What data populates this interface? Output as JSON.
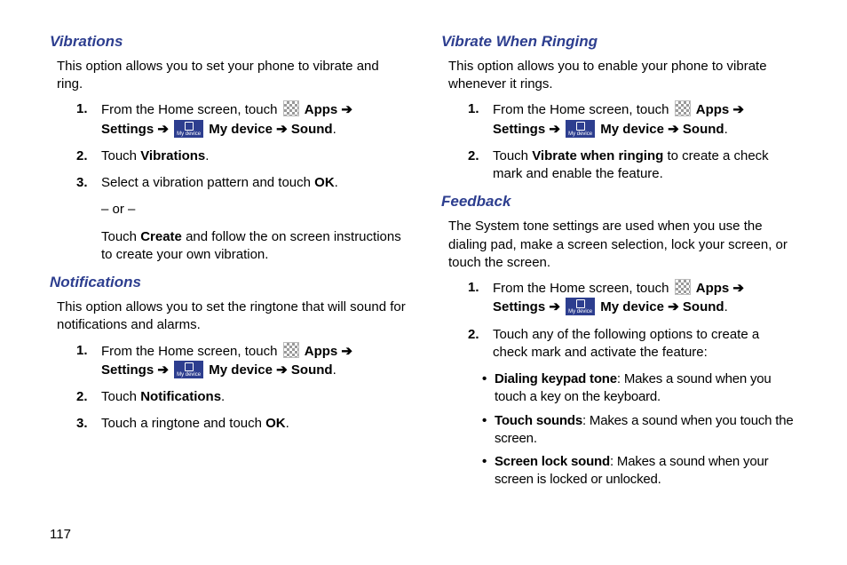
{
  "page_number": "117",
  "left": {
    "vibrations": {
      "heading": "Vibrations",
      "intro": "This option allows you to set your phone to vibrate and ring.",
      "steps": [
        {
          "num": "1.",
          "pre": "From the Home screen, touch ",
          "apps": "Apps",
          "arrow1": " ➔ ",
          "settings": "Settings",
          "arrow2": " ➔ ",
          "mydevice_badge": "My device",
          "mydevice": "My device",
          "arrow3": " ➔ ",
          "sound": "Sound",
          "post": "."
        },
        {
          "num": "2.",
          "pre": "Touch ",
          "bold": "Vibrations",
          "post": "."
        },
        {
          "num": "3.",
          "pre": "Select a vibration pattern and touch ",
          "bold": "OK",
          "post": "."
        }
      ],
      "or": "– or –",
      "create": {
        "pre": "Touch ",
        "bold": "Create",
        "post": " and follow the on screen instructions to create your own vibration."
      }
    },
    "notifications": {
      "heading": "Notifications",
      "intro": "This option allows you to set the ringtone that will sound for notifications and alarms.",
      "steps": [
        {
          "num": "1.",
          "pre": "From the Home screen, touch ",
          "apps": "Apps",
          "arrow1": " ➔ ",
          "settings": "Settings",
          "arrow2": " ➔ ",
          "mydevice_badge": "My device",
          "mydevice": "My device",
          "arrow3": " ➔ ",
          "sound": "Sound",
          "post": "."
        },
        {
          "num": "2.",
          "pre": "Touch ",
          "bold": "Notifications",
          "post": "."
        },
        {
          "num": "3.",
          "pre": "Touch a ringtone and touch ",
          "bold": "OK",
          "post": "."
        }
      ]
    }
  },
  "right": {
    "vibrate_ringing": {
      "heading": "Vibrate When Ringing",
      "intro": "This option allows you to enable your phone to vibrate whenever it rings.",
      "steps": [
        {
          "num": "1.",
          "pre": "From the Home screen, touch ",
          "apps": "Apps",
          "arrow1": " ➔ ",
          "settings": "Settings",
          "arrow2": " ➔ ",
          "mydevice_badge": "My device",
          "mydevice": "My device",
          "arrow3": " ➔ ",
          "sound": "Sound",
          "post": "."
        },
        {
          "num": "2.",
          "pre": "Touch ",
          "bold": "Vibrate when ringing",
          "post": " to create a check mark and enable the feature."
        }
      ]
    },
    "feedback": {
      "heading": "Feedback",
      "intro": "The System tone settings are used when you use the dialing pad, make a screen selection, lock your screen, or touch the screen.",
      "steps": [
        {
          "num": "1.",
          "pre": "From the Home screen, touch ",
          "apps": "Apps",
          "arrow1": " ➔ ",
          "settings": "Settings",
          "arrow2": " ➔ ",
          "mydevice_badge": "My device",
          "mydevice": "My device",
          "arrow3": " ➔ ",
          "sound": "Sound",
          "post": "."
        },
        {
          "num": "2.",
          "pre": "Touch any of the following options to create a check mark and activate the feature:"
        }
      ],
      "bullets": [
        {
          "bold": "Dialing keypad tone",
          "text": ": Makes a sound when you touch a key on the keyboard."
        },
        {
          "bold": "Touch sounds",
          "text": ": Makes a sound when you touch the screen."
        },
        {
          "bold": "Screen lock sound",
          "text": ": Makes a sound when your screen is locked or unlocked."
        }
      ]
    }
  }
}
